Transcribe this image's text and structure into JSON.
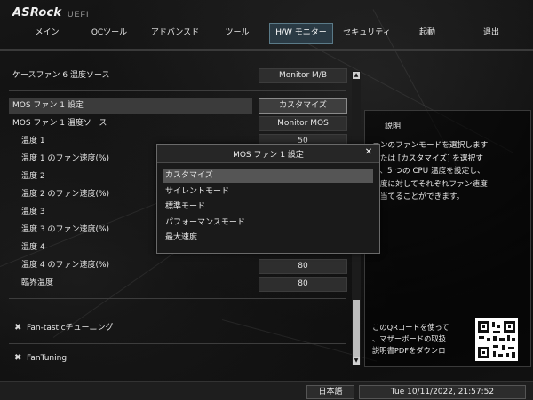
{
  "brand": {
    "logo": "ASRock",
    "sub": "UEFI"
  },
  "nav": {
    "tabs": [
      {
        "label": "メイン"
      },
      {
        "label": "OCツール"
      },
      {
        "label": "アドバンスド"
      },
      {
        "label": "ツール"
      },
      {
        "label": "H/W モニター"
      },
      {
        "label": "セキュリティ"
      },
      {
        "label": "起動"
      },
      {
        "label": "退出"
      }
    ],
    "active": "H/W モニター"
  },
  "settings": {
    "case_fan6_source": {
      "label": "ケースファン 6 温度ソース",
      "value": "Monitor M/B"
    },
    "mos_fan1_setting": {
      "label": "MOS ファン 1 設定",
      "value": "カスタマイズ"
    },
    "mos_fan1_source": {
      "label": "MOS ファン 1 温度ソース",
      "value": "Monitor MOS"
    },
    "temp1": {
      "label": "温度 1",
      "value": "50"
    },
    "temp1_speed": {
      "label": "温度 1 のファン速度(%)"
    },
    "temp2": {
      "label": "温度 2"
    },
    "temp2_speed": {
      "label": "温度 2 のファン速度(%)"
    },
    "temp3": {
      "label": "温度 3"
    },
    "temp3_speed": {
      "label": "温度 3 のファン速度(%)"
    },
    "temp4": {
      "label": "温度 4"
    },
    "temp4_speed": {
      "label": "温度 4 のファン速度(%)",
      "value": "80"
    },
    "critical_temp": {
      "label": "臨界温度",
      "value": "80"
    }
  },
  "tools": {
    "fantastic": "Fan-tasticチューニング",
    "fantuning": "FanTuning"
  },
  "description": {
    "title": "説明",
    "lines": [
      "ァンのファンモードを選択します",
      "または [カスタマイズ] を選択す",
      "と、5 つの CPU 温度を設定し、",
      "温度に対してそれぞれファン速度",
      "割当てることができます。"
    ],
    "qr_lines": [
      "このQRコードを使って",
      "、マザーボードの取扱",
      "説明書PDFをダウンロ"
    ]
  },
  "modal": {
    "title": "MOS ファン 1 設定",
    "close": "✕",
    "options": [
      {
        "label": "カスタマイズ",
        "selected": true
      },
      {
        "label": "サイレントモード",
        "selected": false
      },
      {
        "label": "標準モード",
        "selected": false
      },
      {
        "label": "パフォーマンスモード",
        "selected": false
      },
      {
        "label": "最大速度",
        "selected": false
      }
    ]
  },
  "status": {
    "language": "日本語",
    "datetime": "Tue 10/11/2022, 21:57:52"
  },
  "icons": {
    "scroll_up": "up-arrow-icon",
    "scroll_down": "down-arrow-icon",
    "tool": "wrench-icon",
    "close": "close-icon"
  }
}
